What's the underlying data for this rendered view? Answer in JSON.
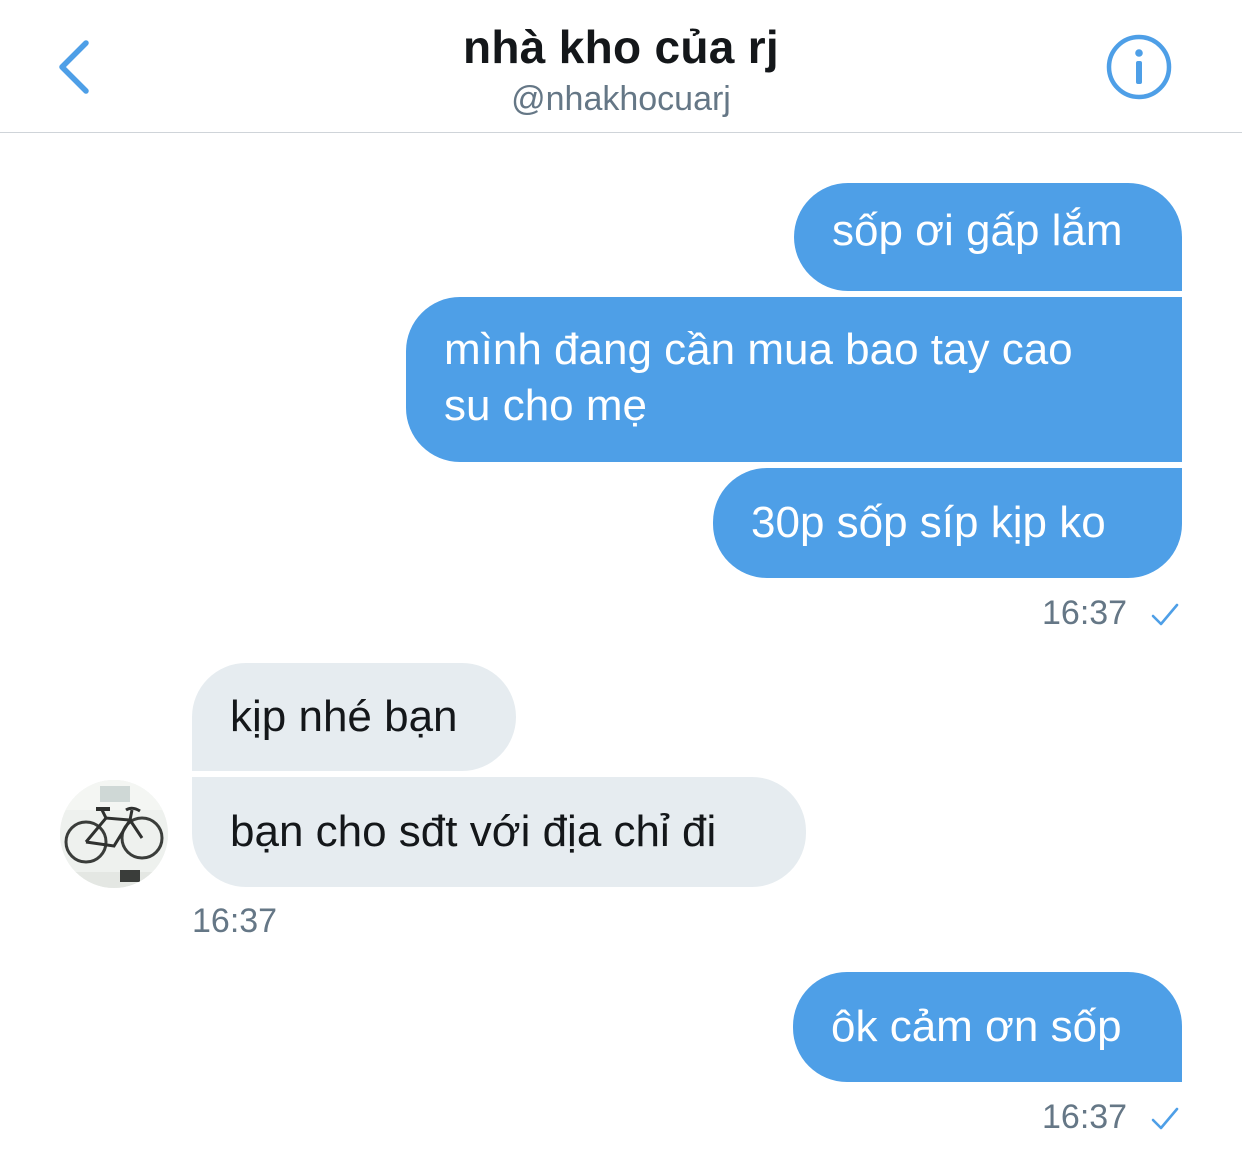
{
  "header": {
    "title": "nhà kho của rj",
    "handle": "@nhakhocuarj",
    "back_icon": "chevron-left-icon",
    "info_icon": "info-circle-icon",
    "accent_color": "#4e9fe7"
  },
  "messages": {
    "out1": "sốp ơi gấp lắm",
    "out2_line1": "mình đang cần mua bao tay cao",
    "out2_line2": "su cho mẹ",
    "out3": "30p sốp síp kịp ko",
    "time1": "16:37",
    "in1": "kịp nhé bạn",
    "in2": "bạn cho sđt với địa chỉ đi",
    "time2": "16:37",
    "out4": "ôk cảm ơn sốp",
    "time3": "16:37"
  },
  "colors": {
    "outgoing_bubble": "#4e9fe7",
    "incoming_bubble": "#e6ecf0",
    "timestamp": "#657786"
  }
}
